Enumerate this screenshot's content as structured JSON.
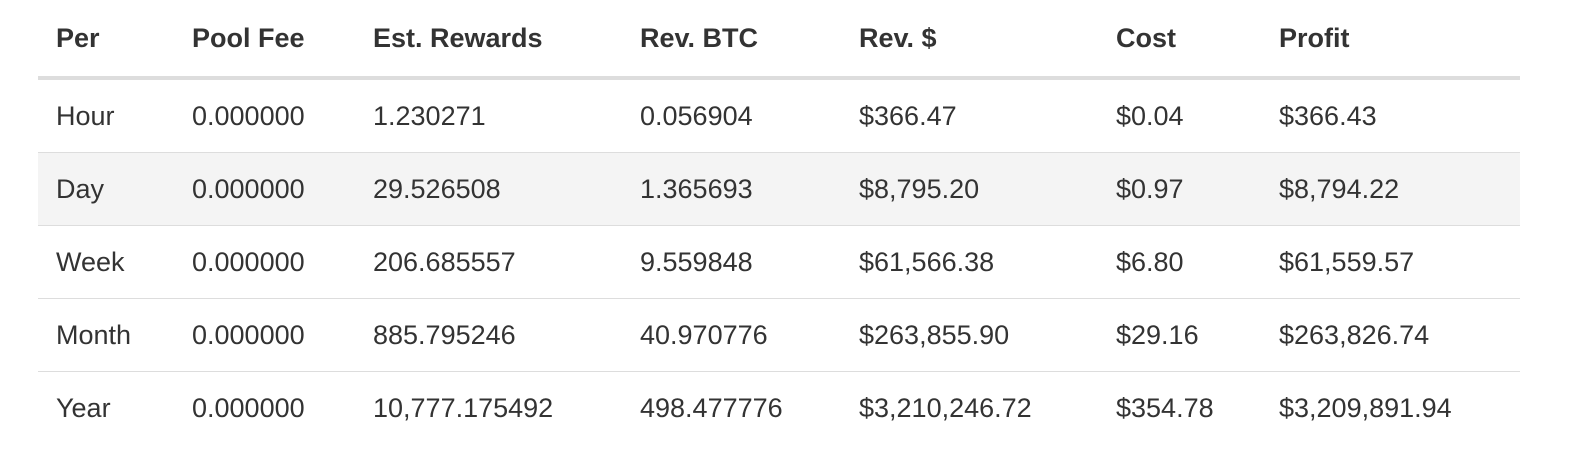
{
  "table": {
    "headers": [
      "Per",
      "Pool Fee",
      "Est. Rewards",
      "Rev. BTC",
      "Rev. $",
      "Cost",
      "Profit"
    ],
    "rows": [
      [
        "Hour",
        "0.000000",
        "1.230271",
        "0.056904",
        "$366.47",
        "$0.04",
        "$366.43"
      ],
      [
        "Day",
        "0.000000",
        "29.526508",
        "1.365693",
        "$8,795.20",
        "$0.97",
        "$8,794.22"
      ],
      [
        "Week",
        "0.000000",
        "206.685557",
        "9.559848",
        "$61,566.38",
        "$6.80",
        "$61,559.57"
      ],
      [
        "Month",
        "0.000000",
        "885.795246",
        "40.970776",
        "$263,855.90",
        "$29.16",
        "$263,826.74"
      ],
      [
        "Year",
        "0.000000",
        "10,777.175492",
        "498.477776",
        "$3,210,246.72",
        "$354.78",
        "$3,209,891.94"
      ]
    ]
  }
}
